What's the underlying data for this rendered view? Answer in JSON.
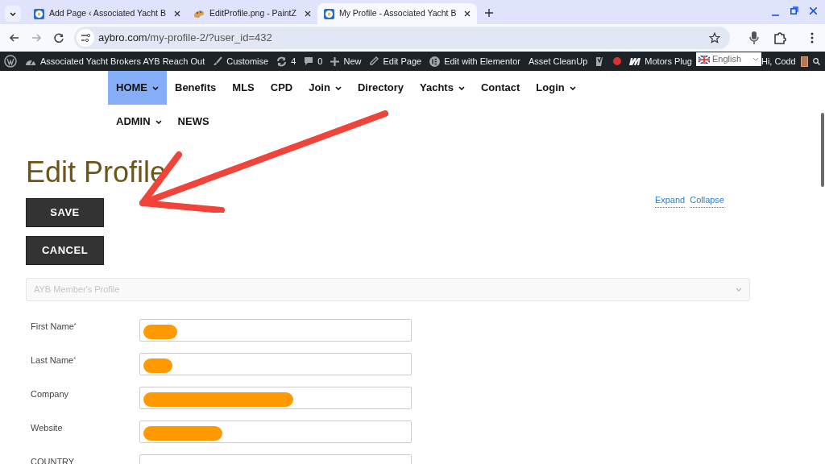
{
  "browser": {
    "tabs": [
      {
        "title": "Add Page ‹ Associated Yacht B",
        "selected": false,
        "kind": "site"
      },
      {
        "title": "EditProfile.png - PaintZ",
        "selected": false,
        "kind": "paint"
      },
      {
        "title": "My Profile - Associated Yacht B",
        "selected": true,
        "kind": "site"
      }
    ],
    "address": {
      "host": "aybro.com",
      "path": "/my-profile-2/?user_id=432"
    }
  },
  "admin_bar": {
    "items": [
      {
        "kind": "wp"
      },
      {
        "kind": "site",
        "label": "Associated Yacht Brokers AYB Reach Out"
      },
      {
        "kind": "brush",
        "label": "Customise"
      },
      {
        "kind": "updates",
        "label": "4"
      },
      {
        "kind": "comments",
        "label": "0"
      },
      {
        "kind": "new",
        "label": "New"
      },
      {
        "kind": "edit",
        "label": "Edit Page"
      },
      {
        "kind": "elementor",
        "label": "Edit with Elementor"
      },
      {
        "kind": "text",
        "label": "Asset CleanUp"
      },
      {
        "kind": "yoast"
      },
      {
        "kind": "dot"
      },
      {
        "kind": "motors",
        "label": "Motors Plug"
      }
    ],
    "language": "English",
    "greeting": "Hi, Codd"
  },
  "nav": {
    "rows": [
      [
        {
          "label": "HOME",
          "dropdown": true,
          "selected": true
        },
        {
          "label": "Benefits",
          "dropdown": false,
          "selected": false
        },
        {
          "label": "MLS",
          "dropdown": false,
          "selected": false
        },
        {
          "label": "CPD",
          "dropdown": false,
          "selected": false
        },
        {
          "label": "Join",
          "dropdown": true,
          "selected": false
        },
        {
          "label": "Directory",
          "dropdown": false,
          "selected": false
        },
        {
          "label": "Yachts",
          "dropdown": true,
          "selected": false
        },
        {
          "label": "Contact",
          "dropdown": false,
          "selected": false
        },
        {
          "label": "Login",
          "dropdown": true,
          "selected": false
        }
      ],
      [
        {
          "label": "ADMIN",
          "dropdown": true,
          "selected": false
        },
        {
          "label": "NEWS",
          "dropdown": false,
          "selected": false
        }
      ]
    ]
  },
  "page": {
    "title": "Edit Profile",
    "buttons": [
      "SAVE",
      "CANCEL"
    ],
    "links": [
      "Expand",
      "Collapse"
    ],
    "section": {
      "title": "AYB Member's Profile",
      "expanded": false
    },
    "fields": [
      {
        "label": "First Name",
        "asterisk": "*"
      },
      {
        "label": "Last Name",
        "asterisk": "*"
      },
      {
        "label": "Company"
      },
      {
        "label": "Website"
      },
      {
        "label": "COUNTRY"
      }
    ]
  }
}
